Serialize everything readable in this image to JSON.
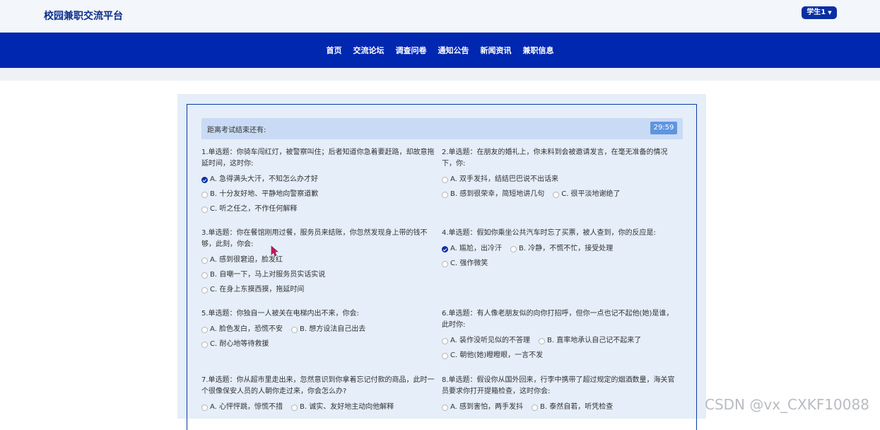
{
  "header": {
    "brand": "校园兼职交流平台",
    "user_label": "学生1"
  },
  "nav": [
    "首页",
    "交流论坛",
    "调查问卷",
    "通知公告",
    "新闻资讯",
    "兼职信息"
  ],
  "exam": {
    "timer_label": "距离考试结束还有:",
    "timer_value": "29:59"
  },
  "questions": [
    {
      "title": "1.单选题：你骑车闯红灯，被警察叫住；后者知道你急着要赶路，却故意拖延时间，这时你:",
      "options": [
        "A. 急得满头大汗，不知怎么办才好",
        "B. 十分友好地、平静地向警察道歉",
        "C. 听之任之，不作任何解释"
      ],
      "selected": 0
    },
    {
      "title": "2.单选题：在朋友的婚礼上，你未料到会被邀请发言，在毫无准备的情况下，你:",
      "options": [
        "A. 双手发抖，结结巴巴说不出话来",
        "B. 感到很荣幸，简短地讲几句",
        "C. 很平淡地谢绝了"
      ],
      "selected": -1
    },
    {
      "title": "3.单选题：你在餐馆刚用过餐，服务员来结账，你忽然发现身上带的钱不够，此刻，你会:",
      "options": [
        "A. 感到很窘迫，脸发红",
        "B. 自嘲一下，马上对服务员实话实说",
        "C. 在身上东摸西摸，拖延时间"
      ],
      "selected": -1
    },
    {
      "title": "4.单选题：假如你乘坐公共汽车时忘了买票，被人查到，你的反应是:",
      "options": [
        "A. 尴尬，出冷汗",
        "B. 冷静，不慌不忙，接受处理",
        "C. 强作微笑"
      ],
      "selected": 0
    },
    {
      "title": "5.单选题：你独自一人被关在电梯内出不来，你会:",
      "options": [
        "A. 脸色发白，恐慌不安",
        "B. 想方设法自己出去",
        "C. 耐心地等待救援"
      ],
      "selected": -1
    },
    {
      "title": "6.单选题：有人像老朋友似的向你打招呼，但你一点也记不起他(她)是谁，此时你:",
      "options": [
        "A. 装作没听见似的不答理",
        "B. 直率地承认自己记不起来了",
        "C. 朝他(她)瞪瞪眼，一言不发"
      ],
      "selected": -1
    },
    {
      "title": "7.单选题：你从超市里走出来，忽然意识到你拿着忘记付款的商品，此时一个很像保安人员的人朝你走过来，你会怎么办?",
      "options": [
        "A. 心怦怦跳，惊慌不措",
        "B. 诚实、友好地主动向他解释"
      ],
      "selected": -1
    },
    {
      "title": "8.单选题：假设你从国外回来，行李中携带了超过规定的烟酒数量，海关官员要求你打开提箱检查，这时你会:",
      "options": [
        "A. 感到害怕，两手发抖",
        "B. 泰然自若，听凭检查"
      ],
      "selected": -1
    }
  ],
  "watermark": "CSDN @vx_CXKF10088"
}
